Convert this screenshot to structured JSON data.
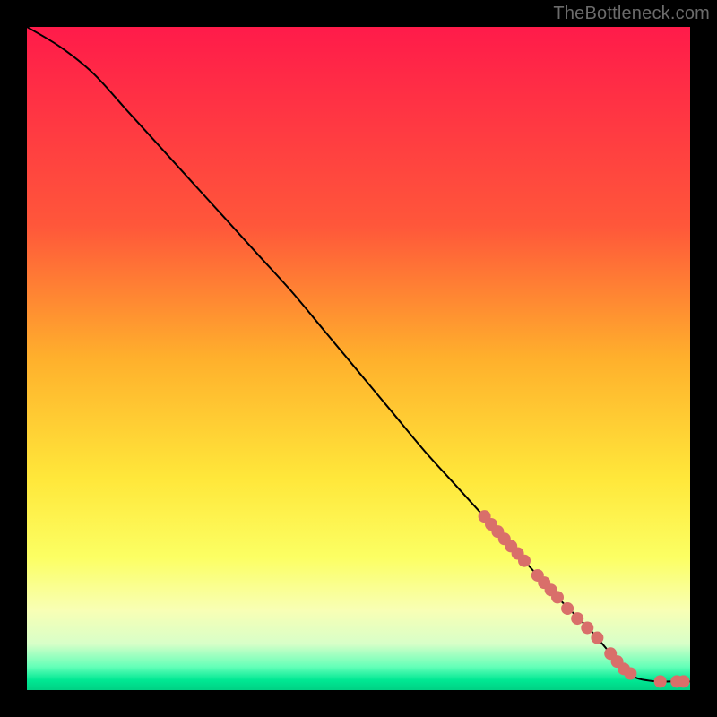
{
  "attribution": "TheBottleneck.com",
  "chart_data": {
    "type": "line",
    "title": "",
    "xlabel": "",
    "ylabel": "",
    "xlim": [
      0,
      100
    ],
    "ylim": [
      0,
      100
    ],
    "gradient_bands": [
      {
        "offset": 0.0,
        "color": "#ff1b4a"
      },
      {
        "offset": 0.3,
        "color": "#ff573a"
      },
      {
        "offset": 0.5,
        "color": "#ffb02c"
      },
      {
        "offset": 0.68,
        "color": "#ffe73a"
      },
      {
        "offset": 0.8,
        "color": "#fcff63"
      },
      {
        "offset": 0.88,
        "color": "#f8ffb5"
      },
      {
        "offset": 0.93,
        "color": "#d8ffc8"
      },
      {
        "offset": 0.965,
        "color": "#63ffb8"
      },
      {
        "offset": 0.985,
        "color": "#00e893"
      },
      {
        "offset": 1.0,
        "color": "#00d184"
      }
    ],
    "series": [
      {
        "name": "bottleneck-curve",
        "points_xy": [
          [
            0,
            100
          ],
          [
            5,
            97
          ],
          [
            10,
            93
          ],
          [
            15,
            87.5
          ],
          [
            20,
            82
          ],
          [
            25,
            76.5
          ],
          [
            30,
            71
          ],
          [
            35,
            65.5
          ],
          [
            40,
            60
          ],
          [
            45,
            54
          ],
          [
            50,
            48
          ],
          [
            55,
            42
          ],
          [
            60,
            36
          ],
          [
            65,
            30.5
          ],
          [
            70,
            25
          ],
          [
            75,
            19.5
          ],
          [
            80,
            14
          ],
          [
            85,
            9
          ],
          [
            88,
            5.5
          ],
          [
            90,
            3.2
          ],
          [
            92,
            1.8
          ],
          [
            95,
            1.3
          ],
          [
            97,
            1.3
          ],
          [
            100,
            1.3
          ]
        ]
      }
    ],
    "markers": {
      "name": "highlighted-points",
      "color": "#d96f6a",
      "radius_px": 7,
      "points_xy": [
        [
          69,
          26.2
        ],
        [
          70,
          25.0
        ],
        [
          71,
          23.9
        ],
        [
          72,
          22.8
        ],
        [
          73,
          21.7
        ],
        [
          74,
          20.6
        ],
        [
          75,
          19.5
        ],
        [
          77,
          17.3
        ],
        [
          78,
          16.2
        ],
        [
          79,
          15.1
        ],
        [
          80,
          14.0
        ],
        [
          81.5,
          12.3
        ],
        [
          83,
          10.8
        ],
        [
          84.5,
          9.4
        ],
        [
          86,
          7.9
        ],
        [
          88,
          5.5
        ],
        [
          89,
          4.3
        ],
        [
          90,
          3.2
        ],
        [
          91,
          2.5
        ],
        [
          95.5,
          1.3
        ],
        [
          98,
          1.3
        ],
        [
          99,
          1.3
        ]
      ]
    }
  }
}
